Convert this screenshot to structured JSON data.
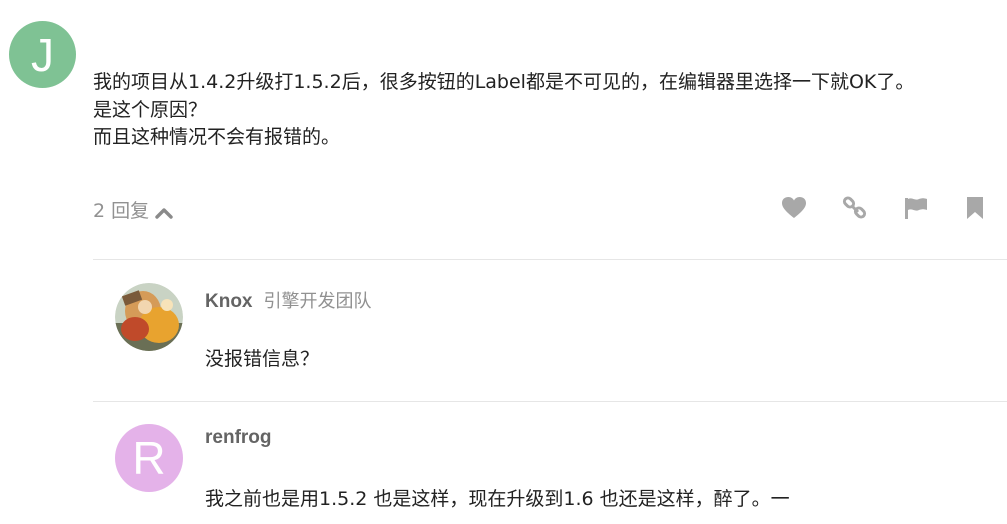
{
  "post": {
    "avatar_letter": "J",
    "avatar_color": "#7fc294",
    "lines": [
      "我的项目从1.4.2升级打1.5.2后，很多按钮的Label都是不可见的，在编辑器里选择一下就OK了。",
      "是这个原因？",
      "而且这种情况不会有报错的。"
    ],
    "replies_label": "2 回复"
  },
  "actions": [
    "heart-icon",
    "link-icon",
    "flag-icon",
    "bookmark-icon"
  ],
  "replies": [
    {
      "username": "Knox",
      "group": "引擎开发团队",
      "text": "没报错信息？"
    },
    {
      "username": "renfrog",
      "avatar_letter": "R",
      "avatar_color": "#e4b2e9",
      "text": "我之前也是用1.5.2 也是这样，现在升级到1.6 也还是这样，醉了。一"
    }
  ]
}
